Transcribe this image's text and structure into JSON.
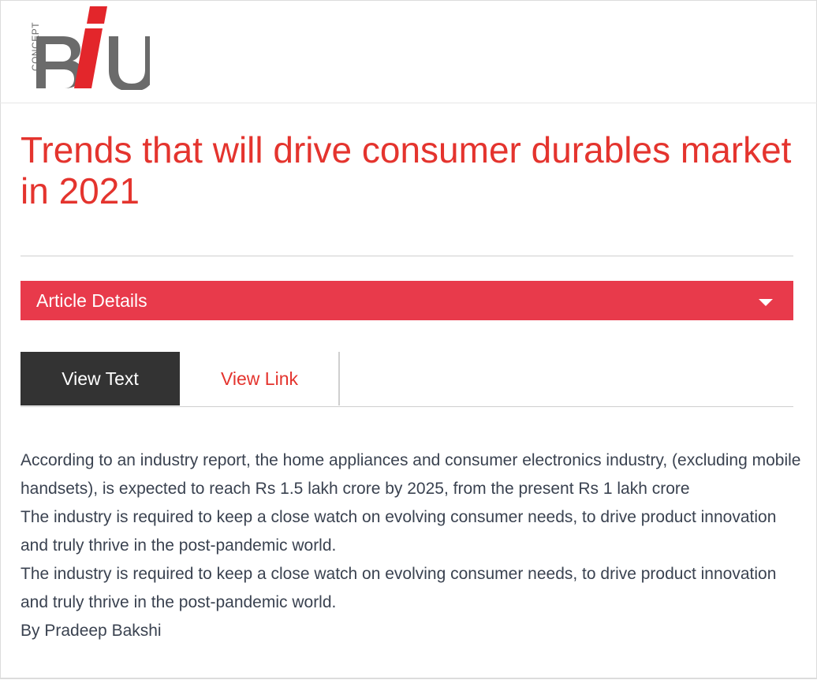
{
  "logo": {
    "side_text": "CONCEPT",
    "main_text": "BIU",
    "colors": {
      "gray": "#6b6b6b",
      "red": "#e3262b"
    }
  },
  "article": {
    "title": "Trends that will drive consumer durables market in 2021"
  },
  "details_bar": {
    "label": "Article Details",
    "icon": "caret-down-icon"
  },
  "tabs": [
    {
      "label": "View Text",
      "active": true
    },
    {
      "label": "View Link",
      "active": false
    }
  ],
  "content": {
    "paragraphs": [
      "According to an industry report, the home appliances and consumer electronics industry, (excluding mobile handsets), is expected to reach Rs 1.5 lakh crore by 2025, from the present Rs 1 lakh crore",
      "The industry is required to keep a close watch on evolving consumer needs, to drive product innovation and truly thrive in the post-pandemic world.",
      "The industry is required to keep a close watch on evolving consumer needs, to drive product innovation and truly thrive in the post-pandemic world."
    ],
    "byline": "By Pradeep Bakshi"
  },
  "colors": {
    "accent_red": "#e4342e",
    "bar_red": "#e83a4b",
    "tab_active_bg": "#333333",
    "body_text": "#3a4250"
  }
}
